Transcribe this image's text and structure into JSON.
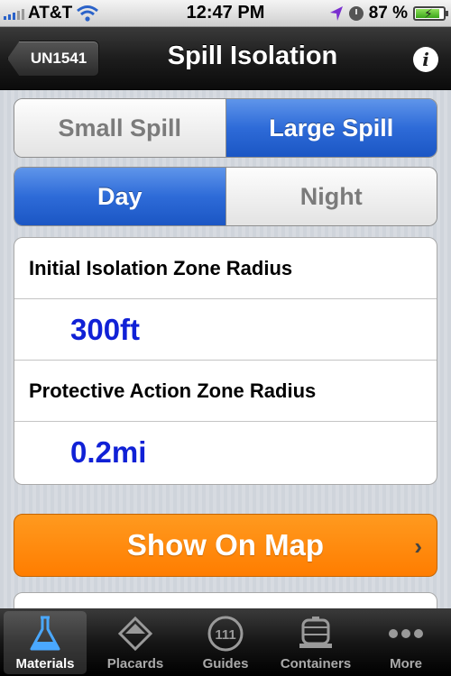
{
  "status_bar": {
    "carrier": "AT&T",
    "time": "12:47 PM",
    "battery": "87 %",
    "battery_level": 0.87
  },
  "nav": {
    "back_label": "UN1541",
    "title": "Spill Isolation",
    "info_icon": "info-icon"
  },
  "spill_toggle": {
    "options": [
      "Small Spill",
      "Large Spill"
    ],
    "selected": "Large Spill"
  },
  "time_toggle": {
    "options": [
      "Day",
      "Night"
    ],
    "selected": "Day"
  },
  "zones": {
    "initial_label": "Initial Isolation Zone Radius",
    "initial_value": "300ft",
    "protective_label": "Protective Action Zone Radius",
    "protective_value": "0.2mi"
  },
  "show_map": {
    "label": "Show On Map",
    "chevron": "›"
  },
  "tabs": [
    {
      "label": "Materials",
      "icon": "flask-icon",
      "active": true
    },
    {
      "label": "Placards",
      "icon": "placard-icon",
      "active": false
    },
    {
      "label": "Guides",
      "icon": "guides-icon",
      "badge": "111",
      "active": false
    },
    {
      "label": "Containers",
      "icon": "tanker-icon",
      "active": false
    },
    {
      "label": "More",
      "icon": "more-icon",
      "active": false
    }
  ],
  "colors": {
    "accent_blue": "#2e6bd8",
    "value_blue": "#1021d6",
    "orange": "#ff8a00"
  }
}
